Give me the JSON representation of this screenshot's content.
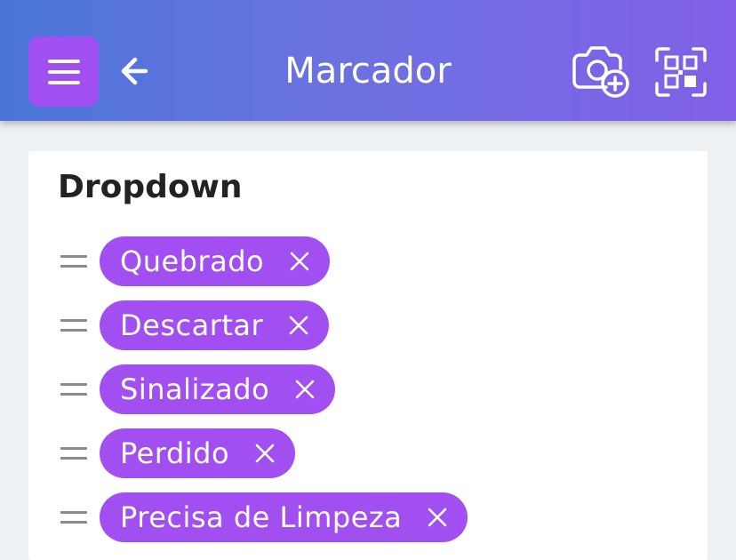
{
  "header": {
    "title": "Marcador",
    "icons": [
      "menu-icon",
      "arrow-back-icon",
      "camera-plus-icon",
      "qr-scan-icon"
    ]
  },
  "card": {
    "title": "Dropdown",
    "items": [
      {
        "label": "Quebrado"
      },
      {
        "label": "Descartar"
      },
      {
        "label": "Sinalizado"
      },
      {
        "label": "Perdido"
      },
      {
        "label": "Precisa de Limpeza"
      }
    ]
  },
  "colors": {
    "accent": "#a24ff1",
    "header_gradient_start": "#4a76d8",
    "header_gradient_end": "#8160e6",
    "background": "#eef1f4",
    "card": "#ffffff",
    "text_dark": "#222222",
    "handle": "#8a8a8a"
  }
}
